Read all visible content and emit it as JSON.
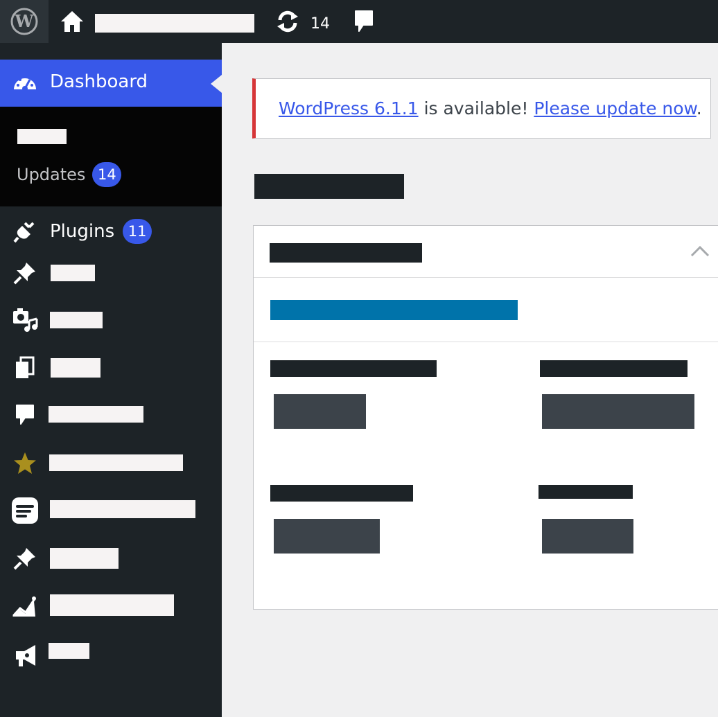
{
  "adminbar": {
    "updates_count": "14",
    "icons": [
      "wordpress-logo-icon",
      "home-icon",
      "refresh-icon",
      "comment-icon"
    ]
  },
  "sidebar": {
    "current": {
      "label": "Dashboard",
      "icon": "dashboard-icon"
    },
    "submenu": {
      "updates_label": "Updates",
      "updates_count": "14"
    },
    "plugins": {
      "label": "Plugins",
      "count": "11",
      "icon": "plugin-icon"
    },
    "icons": [
      "pin-icon",
      "media-icon",
      "pages-icon",
      "comment-icon",
      "star-icon",
      "form-icon",
      "pin-icon",
      "chart-icon",
      "megaphone-icon"
    ]
  },
  "notice": {
    "link_version": "WordPress 6.1.1",
    "middle_text": " is available! ",
    "link_update": "Please update now",
    "end_text": "."
  },
  "colors": {
    "adminbar_bg": "#1d2327",
    "accent": "#3858e9",
    "notice_border": "#d63638",
    "progress": "#0073aa"
  }
}
